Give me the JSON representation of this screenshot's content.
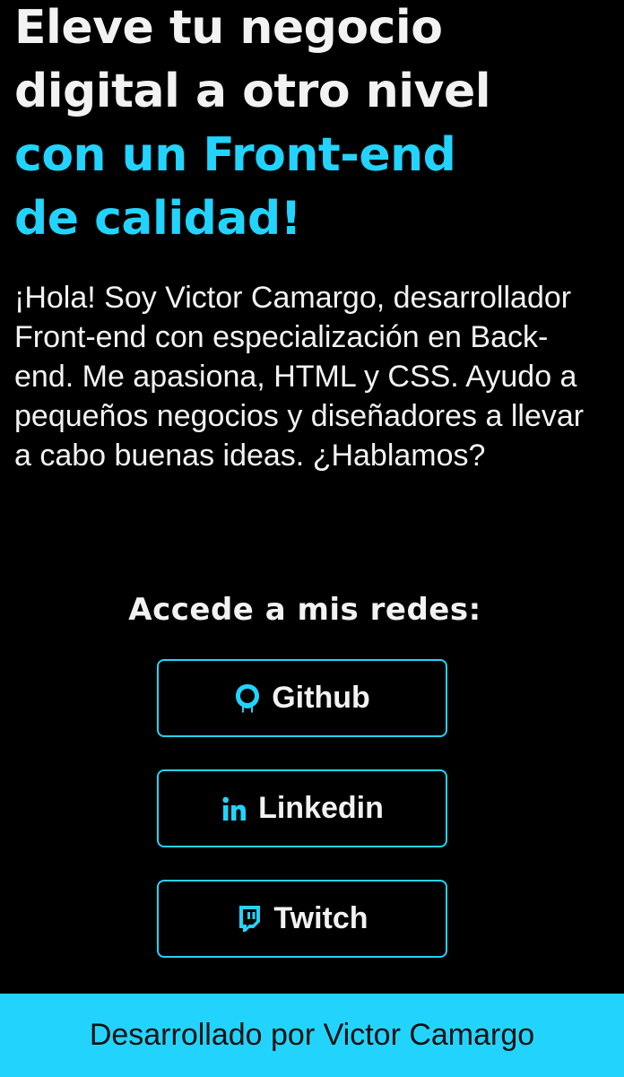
{
  "hero": {
    "headline_line1": "Eleve tu negocio",
    "headline_line2": "digital a otro nivel",
    "headline_accent_line1": "con un Front-end",
    "headline_accent_line2": "de calidad!"
  },
  "intro": {
    "text": "¡Hola! Soy Victor Camargo, desarrollador Front-end con especialización en Back-end. Me apasiona, HTML y CSS. Ayudo a pequeños negocios y diseñadores a llevar a cabo buenas ideas. ¿Hablamos?"
  },
  "socials": {
    "title": "Accede a mis redes:",
    "items": [
      {
        "label": "Github",
        "icon": "github-icon"
      },
      {
        "label": "Linkedin",
        "icon": "linkedin-icon"
      },
      {
        "label": "Twitch",
        "icon": "twitch-icon"
      }
    ]
  },
  "footer": {
    "text": "Desarrollado por Victor Camargo"
  },
  "colors": {
    "background": "#000000",
    "accent": "#22d4fd",
    "text": "#f2f2f2"
  }
}
